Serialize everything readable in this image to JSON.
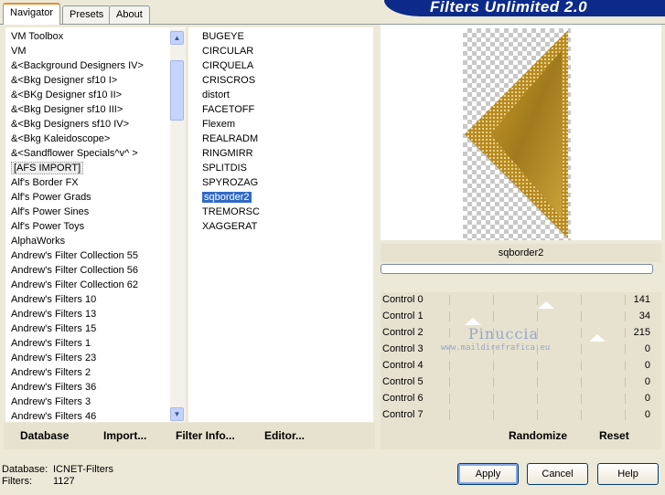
{
  "header": {
    "title": "Filters Unlimited 2.0"
  },
  "tabs": [
    {
      "label": "Navigator",
      "active": true
    },
    {
      "label": "Presets",
      "active": false
    },
    {
      "label": "About",
      "active": false
    }
  ],
  "categories": [
    "VM Toolbox",
    "VM",
    "&<Background Designers IV>",
    "&<Bkg Designer sf10 I>",
    "&<BKg Designer sf10 II>",
    "&<Bkg Designer sf10 III>",
    "&<Bkg Designers sf10 IV>",
    "&<Bkg Kaleidoscope>",
    "&<Sandflower Specials^v^ >",
    "[AFS IMPORT]",
    "Alf's Border FX",
    "Alf's Power Grads",
    "Alf's Power Sines",
    "Alf's Power Toys",
    "AlphaWorks",
    "Andrew's Filter Collection 55",
    "Andrew's Filter Collection 56",
    "Andrew's Filter Collection 62",
    "Andrew's Filters 10",
    "Andrew's Filters 13",
    "Andrew's Filters 15",
    "Andrew's Filters 1",
    "Andrew's Filters 23",
    "Andrew's Filters 2",
    "Andrew's Filters 36",
    "Andrew's Filters 3",
    "Andrew's Filters 46"
  ],
  "filters": [
    "BUGEYE",
    "CIRCULAR",
    "CIRQUELA",
    "CRISCROS",
    "distort",
    "FACETOFF",
    "Flexem",
    "REALRADM",
    "RINGMIRR",
    "SPLITDIS",
    "SPYROZAG",
    "sqborder2",
    "TREMORSC",
    "XAGGERAT"
  ],
  "selected_filter": "sqborder2",
  "selected_category": "[AFS IMPORT]",
  "preview": {
    "filter_name": "sqborder2",
    "progress_percent": 0
  },
  "controls": [
    {
      "label": "Control 0",
      "value": "141",
      "level": 141
    },
    {
      "label": "Control 1",
      "value": "34",
      "level": 34
    },
    {
      "label": "Control 2",
      "value": "215",
      "level": 215
    },
    {
      "label": "Control 3",
      "value": "0",
      "level": 0
    },
    {
      "label": "Control 4",
      "value": "0",
      "level": 0
    },
    {
      "label": "Control 5",
      "value": "0",
      "level": 0
    },
    {
      "label": "Control 6",
      "value": "0",
      "level": 0
    },
    {
      "label": "Control 7",
      "value": "0",
      "level": 0
    }
  ],
  "toolbar": {
    "database": "Database",
    "import": "Import...",
    "filter_info": "Filter Info...",
    "editor": "Editor...",
    "randomize": "Randomize",
    "reset": "Reset"
  },
  "footer": {
    "database_label": "Database:",
    "database_value": "ICNET-Filters",
    "filters_label": "Filters:",
    "filters_value": "1127"
  },
  "buttons": {
    "apply": "Apply",
    "cancel": "Cancel",
    "help": "Help"
  },
  "watermark": {
    "name": "Pinuccia",
    "url": "www.maildirefrafica.eu"
  },
  "colors": {
    "selection": "#316ac5",
    "banner": "#0c2a8a",
    "tab_accent": "#e68b2c",
    "gold": "#b88a1e"
  }
}
